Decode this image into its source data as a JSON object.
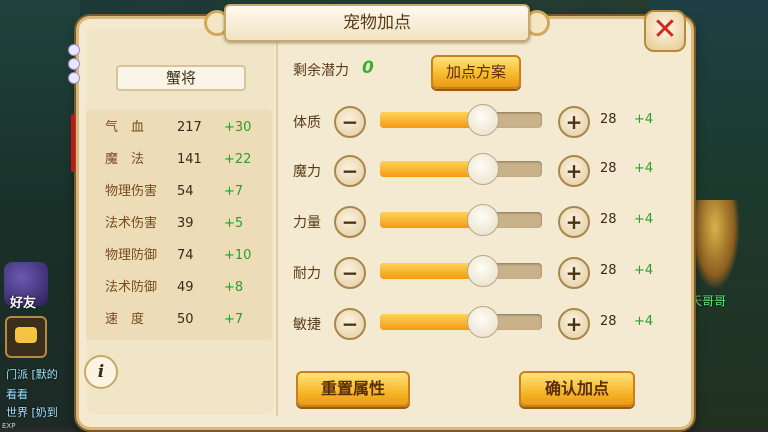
{
  "background": {
    "friend_label": "好友",
    "channels": [
      "门派 [默的",
      "看看",
      "世界 [奶到"
    ],
    "exp_label": "EXP",
    "npc_name": "江天哥哥"
  },
  "window": {
    "title": "宠物加点",
    "close_icon": "close-x-icon"
  },
  "pet": {
    "name": "蟹将",
    "stats": [
      {
        "name": "气　血",
        "value": "217",
        "bonus": "+30"
      },
      {
        "name": "魔　法",
        "value": "141",
        "bonus": "+22"
      },
      {
        "name": "物理伤害",
        "value": "54",
        "bonus": "+7"
      },
      {
        "name": "法术伤害",
        "value": "39",
        "bonus": "+5"
      },
      {
        "name": "物理防御",
        "value": "74",
        "bonus": "+10"
      },
      {
        "name": "法术防御",
        "value": "49",
        "bonus": "+8"
      },
      {
        "name": "速　度",
        "value": "50",
        "bonus": "+7"
      }
    ],
    "info_icon": "info-icon"
  },
  "allocation": {
    "potential_label": "剩余潜力",
    "potential_value": "0",
    "scheme_button": "加点方案",
    "attributes": [
      {
        "name": "体质",
        "value": "28",
        "added": "+4",
        "level": 0.63
      },
      {
        "name": "魔力",
        "value": "28",
        "added": "+4",
        "level": 0.63
      },
      {
        "name": "力量",
        "value": "28",
        "added": "+4",
        "level": 0.63
      },
      {
        "name": "耐力",
        "value": "28",
        "added": "+4",
        "level": 0.63
      },
      {
        "name": "敏捷",
        "value": "28",
        "added": "+4",
        "level": 0.63
      }
    ],
    "reset_button": "重置属性",
    "confirm_button": "确认加点"
  },
  "colors": {
    "accent_gold": "#f7b72a",
    "bonus_green": "#2aa02a",
    "close_red": "#d02a1f"
  }
}
